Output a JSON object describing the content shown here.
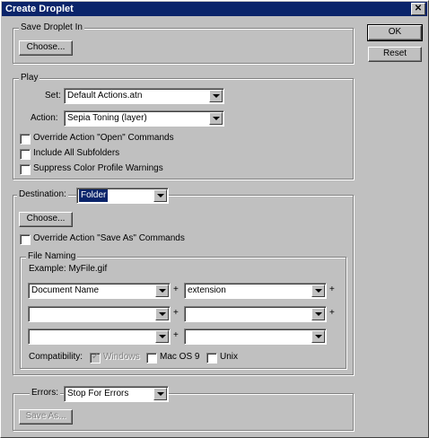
{
  "window": {
    "title": "Create Droplet"
  },
  "buttons": {
    "ok": "OK",
    "reset": "Reset"
  },
  "save_droplet": {
    "legend": "Save Droplet In",
    "choose": "Choose..."
  },
  "play": {
    "legend": "Play",
    "set_label": "Set:",
    "set_value": "Default Actions.atn",
    "action_label": "Action:",
    "action_value": "Sepia Toning (layer)",
    "options": [
      {
        "label": "Override Action \"Open\" Commands",
        "checked": false
      },
      {
        "label": "Include All Subfolders",
        "checked": false
      },
      {
        "label": "Suppress Color Profile Warnings",
        "checked": false
      }
    ]
  },
  "destination": {
    "label": "Destination:",
    "value": "Folder",
    "choose": "Choose...",
    "override_label": "Override Action \"Save As\" Commands",
    "file_naming": {
      "legend": "File Naming",
      "example": "Example: MyFile.gif",
      "fields": [
        "Document Name",
        "extension",
        "",
        "",
        "",
        ""
      ],
      "plus": "+",
      "compat_label": "Compatibility:",
      "compat": [
        {
          "label": "Windows",
          "checked": true,
          "disabled": true
        },
        {
          "label": "Mac OS 9",
          "checked": false,
          "disabled": false
        },
        {
          "label": "Unix",
          "checked": false,
          "disabled": false
        }
      ]
    }
  },
  "errors": {
    "label": "Errors:",
    "value": "Stop For Errors",
    "save_as": "Save As..."
  }
}
